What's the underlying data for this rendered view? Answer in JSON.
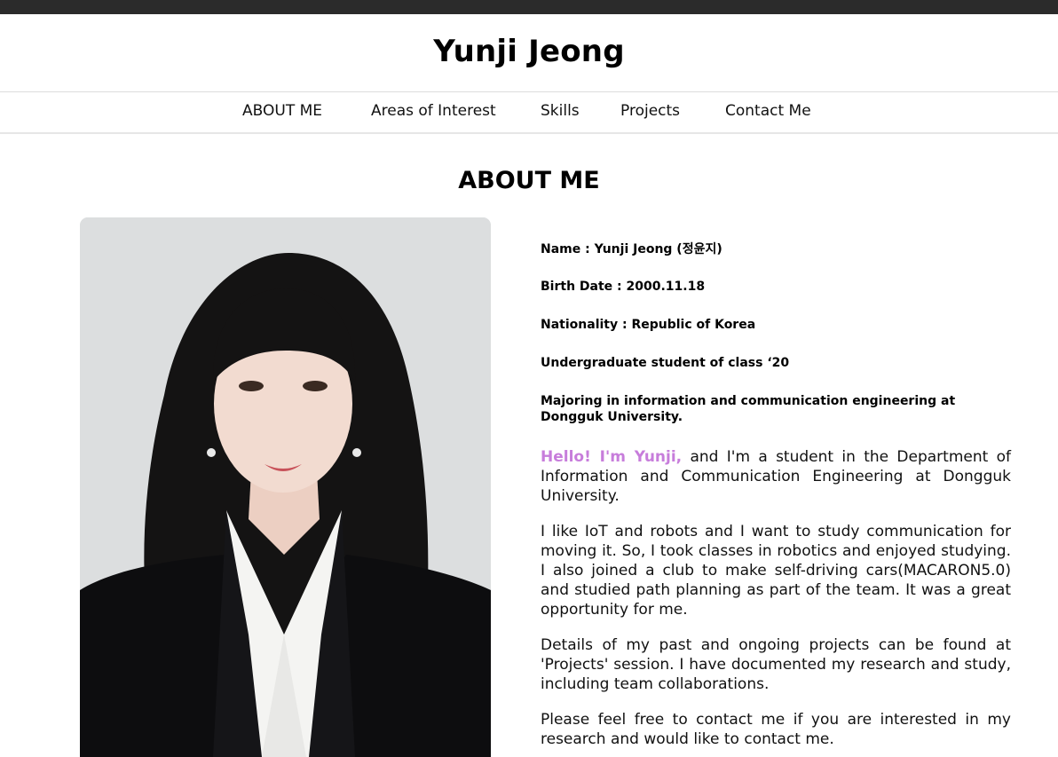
{
  "site": {
    "title": "Yunji Jeong"
  },
  "nav": {
    "items": [
      {
        "label": "ABOUT ME"
      },
      {
        "label": "Areas of Interest"
      },
      {
        "label": "Skills"
      },
      {
        "label": "Projects"
      },
      {
        "label": "Contact Me"
      }
    ]
  },
  "about": {
    "heading": "ABOUT ME",
    "facts": [
      "Name : Yunji Jeong (정윤지)",
      "Birth Date : 2000.11.18",
      "Nationality : Republic of Korea",
      "Undergraduate student of class ‘20",
      "Majoring in information and communication engineering at Dongguk University."
    ],
    "hello": "Hello! I'm Yunji,",
    "intro_rest": " and I'm a student in the Department of Information and Communication Engineering at Dongguk University.",
    "paragraphs": [
      "I like IoT and robots and I want to study communication for moving it. So, I took classes in robotics and enjoyed studying. I also joined a club to make self-driving cars(MACARON5.0) and studied path planning as part of the team. It was a great opportunity for me.",
      "Details of my past and ongoing projects can be found at 'Projects' session. I have documented my research and study, including team collaborations.",
      "Please feel free to contact me if you are interested in my research and would like to contact me."
    ]
  },
  "colors": {
    "accent": "#c77ddb",
    "topbar": "#2b2b2b"
  }
}
